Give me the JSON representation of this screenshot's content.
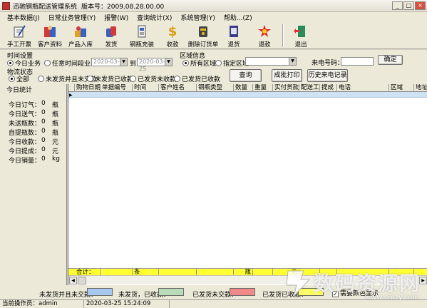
{
  "window": {
    "app_title": "迅驰钢瓶配送管理系统",
    "version_label": "版本号：2009.08.28.00.00"
  },
  "menu": [
    "基本数据(J)",
    "日常业务管理(Y)",
    "报警(W)",
    "查询统计(X)",
    "系统管理(Y)",
    "帮助...(Z)"
  ],
  "toolbar": [
    {
      "label": "手工开票",
      "icon": "pen-paper-icon"
    },
    {
      "label": "客户资料",
      "icon": "customer-book-icon"
    },
    {
      "label": "产品入库",
      "icon": "product-box-icon"
    },
    {
      "label": "发货",
      "icon": "delivery-icon"
    },
    {
      "label": "钢瓶充装",
      "icon": "cylinder-icon"
    },
    {
      "label": "收款",
      "icon": "dollar-icon"
    },
    {
      "label": "删除订货单",
      "icon": "delete-order-icon"
    },
    {
      "label": "退货",
      "icon": "return-icon"
    },
    {
      "label": "退款",
      "icon": "refund-icon"
    },
    {
      "label": "退出",
      "icon": "exit-door-icon"
    }
  ],
  "filter": {
    "time_group_title": "时间设置",
    "today_label": "今日业务",
    "range_label": "任意时间段业务从",
    "date_from": "2020-03-25",
    "to_label": "到",
    "date_to": "2020-03-25",
    "region_group_title": "区域信息",
    "all_regions_label": "所有区域",
    "specific_region_label": "指定区域",
    "caller_label": "来电号码：",
    "confirm_label": "确定",
    "status_group_title": "物流状态",
    "status_options": [
      "全部",
      "未发货并且未交款",
      "未发货已收款",
      "已发货未收款",
      "已发货已收款"
    ],
    "query_label": "查询",
    "print_label": "成批打印",
    "history_label": "历史来电记录"
  },
  "today_stats": {
    "title": "今日统计",
    "rows": [
      {
        "label": "今日订气：",
        "value": "0",
        "unit": "瓶"
      },
      {
        "label": "今日送气：",
        "value": "0",
        "unit": "瓶"
      },
      {
        "label": "未送瓶数：",
        "value": "0",
        "unit": "瓶"
      },
      {
        "label": "自提瓶数：",
        "value": "0",
        "unit": "瓶"
      },
      {
        "label": "今日收款：",
        "value": "0",
        "unit": "元"
      },
      {
        "label": "今日提成：",
        "value": "0",
        "unit": "元"
      },
      {
        "label": "今日销量：",
        "value": "0",
        "unit": "kg"
      }
    ]
  },
  "grid": {
    "columns": [
      "购物日期",
      "单据编号",
      "时间",
      "客户姓名",
      "钢瓶类型",
      "数量",
      "重量",
      "实付货款",
      "配送工",
      "提成",
      "电话",
      "区域",
      "地址"
    ],
    "totals": [
      "合计：",
      "",
      "条",
      "",
      "",
      "瓶",
      "",
      "元",
      "",
      "",
      "",
      "",
      ""
    ]
  },
  "legend": {
    "items": [
      {
        "label": "未发货并且未交款：",
        "color": "#a8c8f0"
      },
      {
        "label": "未发货，已收款：",
        "color": "#b8dcb8"
      },
      {
        "label": "已发货未交款：",
        "color": "#f08a8a"
      },
      {
        "label": "已发货已收款：",
        "color": "#ffff66"
      }
    ],
    "checkbox_label": "需要颜色显示"
  },
  "status_bar": {
    "operator": "当前操作员：admin",
    "datetime": "2020-03-25 15:24:09"
  },
  "watermark": {
    "text": "数码资源网",
    "url": "www.smzy.com"
  }
}
